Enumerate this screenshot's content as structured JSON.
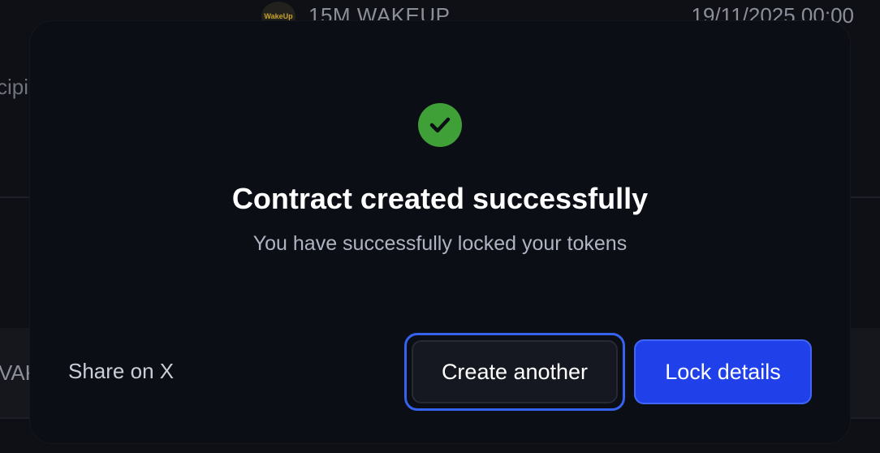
{
  "background": {
    "token_logo_text": "WakeUp",
    "token_name": "15M WAKEUP",
    "date": "19/11/2025  00:00",
    "left_fragment_1": "cipi",
    "left_fragment_2": "VAK"
  },
  "modal": {
    "icon": "check-circle-icon",
    "title": "Contract created successfully",
    "subtitle": "You have successfully locked your tokens",
    "share_label": "Share on X",
    "create_another_label": "Create another",
    "lock_details_label": "Lock details"
  },
  "colors": {
    "success": "#3fa037",
    "primary": "#2041ea",
    "focus_ring": "#3563f0",
    "modal_bg": "#0b0e14"
  }
}
